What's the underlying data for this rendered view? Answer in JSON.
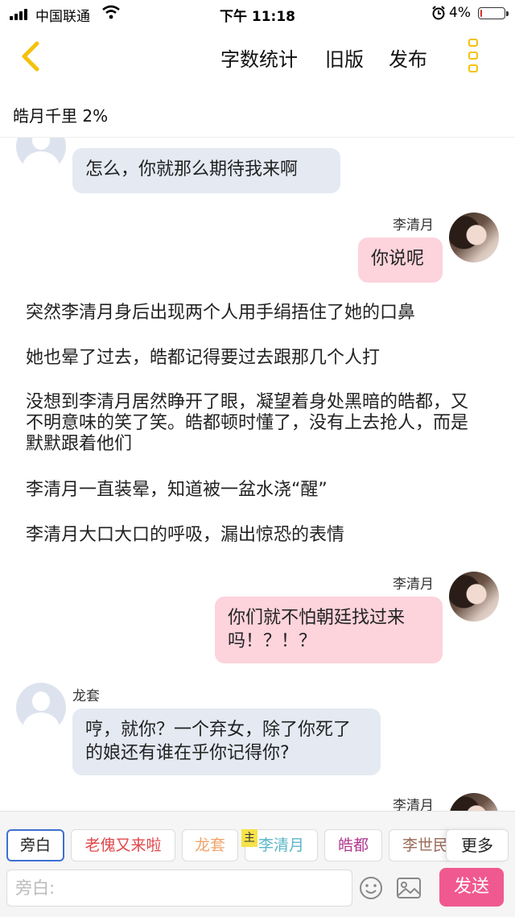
{
  "status_bar": {
    "carrier": "中国联通",
    "time": "下午 11:18",
    "battery": "4%",
    "battery_level": 0.04
  },
  "toolbar": {
    "word_count": "字数统计",
    "old_version": "旧版",
    "publish": "发布"
  },
  "story": {
    "title_line": "皓月千里 2%"
  },
  "messages": [
    {
      "type": "left",
      "speaker": "",
      "text": "怎么，你就那么期待我来啊"
    },
    {
      "type": "right",
      "speaker": "李清月",
      "text": "你说呢"
    },
    {
      "type": "narration",
      "text": "突然李清月身后出现两个人用手绢捂住了她的口鼻"
    },
    {
      "type": "narration",
      "text": "她也晕了过去，皓都记得要过去跟那几个人打"
    },
    {
      "type": "narration",
      "text": "没想到李清月居然睁开了眼，凝望着身处黑暗的皓都，又不明意味的笑了笑。皓都顿时懂了，没有上去抢人，而是默默跟着他们"
    },
    {
      "type": "narration",
      "text": "李清月一直装晕，知道被一盆水浇“醒”"
    },
    {
      "type": "narration",
      "text": "李清月大口大口的呼吸，漏出惊恐的表情"
    },
    {
      "type": "right",
      "speaker": "李清月",
      "text": "你们就不怕朝廷找过来吗！？！？"
    },
    {
      "type": "left",
      "speaker": "龙套",
      "text": "哼，就你？一个弃女，除了你死了的娘还有谁在乎你记得你?"
    },
    {
      "type": "right",
      "speaker": "李清月",
      "text": ""
    }
  ],
  "roles": [
    {
      "label": "旁白",
      "color": "#222222"
    },
    {
      "label": "老傀又来啦",
      "color": "#e0484b"
    },
    {
      "label": "龙套",
      "color": "#f0a46a"
    },
    {
      "label": "李清月",
      "color": "#5bb6c8"
    },
    {
      "label": "皓都",
      "color": "#b0388e"
    },
    {
      "label": "李世民",
      "color": "#9a6b5a"
    }
  ],
  "role_badge": "主",
  "more_label": "更多",
  "input": {
    "placeholder": "旁白:",
    "value": ""
  },
  "send_label": "发送",
  "colors": {
    "accent": "#f4c20d",
    "send": "#f0598f",
    "left_bubble": "#e4e9f2",
    "right_bubble": "#fdd3dc"
  }
}
